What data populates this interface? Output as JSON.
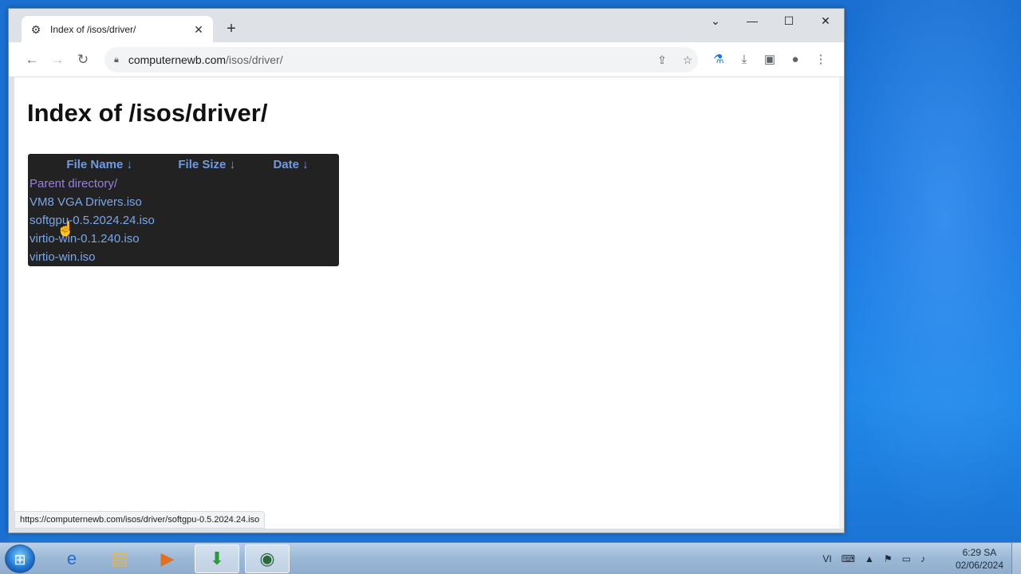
{
  "browser": {
    "tab": {
      "title": "Index of /isos/driver/",
      "close": "✕"
    },
    "new_tab": "+",
    "window_controls": {
      "tab_search": "⌄",
      "minimize": "—",
      "maximize": "☐",
      "close": "✕"
    },
    "nav": {
      "back": "←",
      "forward": "→",
      "reload": "↻"
    },
    "url_host": "computernewb.com",
    "url_path": "/isos/driver/",
    "status_url": "https://computernewb.com/isos/driver/softgpu-0.5.2024.24.iso"
  },
  "page": {
    "title": "Index of /isos/driver/",
    "columns": [
      "File Name  ↓",
      "File Size  ↓",
      "Date  ↓"
    ],
    "rows": [
      {
        "name": "Parent directory/",
        "size": "-",
        "date": "-"
      },
      {
        "name": "VM8 VGA Drivers.iso",
        "size": "",
        "date": ""
      },
      {
        "name": "softgpu-0.5.2024.24.iso",
        "size": "",
        "date": ""
      },
      {
        "name": "virtio-win-0.1.240.iso",
        "size": "",
        "date": ""
      },
      {
        "name": "virtio-win.iso",
        "size": "",
        "date": ""
      }
    ]
  },
  "taskbar": {
    "language": "VI",
    "time": "6:29 SA",
    "date": "02/06/2024"
  },
  "colors": {
    "accent": "#1a73e8",
    "link": "#7aa7e8",
    "table_bg": "#222222"
  }
}
